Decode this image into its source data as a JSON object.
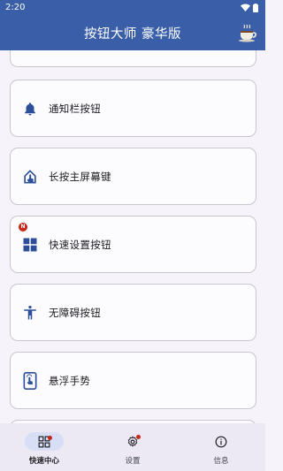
{
  "status_bar": {
    "time": "2:20"
  },
  "app_bar": {
    "title": "按钮大师 豪华版",
    "action_icon": "coffee-cup-icon"
  },
  "cards": [
    {
      "label": "",
      "icon": "none"
    },
    {
      "label": "通知栏按钮",
      "icon": "bell-icon"
    },
    {
      "label": "长按主屏幕键",
      "icon": "home-touch-icon"
    },
    {
      "label": "快速设置按钮",
      "icon": "grid-icon",
      "badge": "N"
    },
    {
      "label": "无障碍按钮",
      "icon": "accessibility-icon"
    },
    {
      "label": "悬浮手势",
      "icon": "phone-gesture-icon"
    }
  ],
  "nav": [
    {
      "label": "快速中心",
      "icon": "quick-center-icon",
      "active": true
    },
    {
      "label": "设置",
      "icon": "gear-icon",
      "active": false
    },
    {
      "label": "信息",
      "icon": "info-icon",
      "active": false
    }
  ],
  "colors": {
    "primary": "#3a5fa8",
    "badge": "#c7281c",
    "icon": "#2d4f9a"
  }
}
